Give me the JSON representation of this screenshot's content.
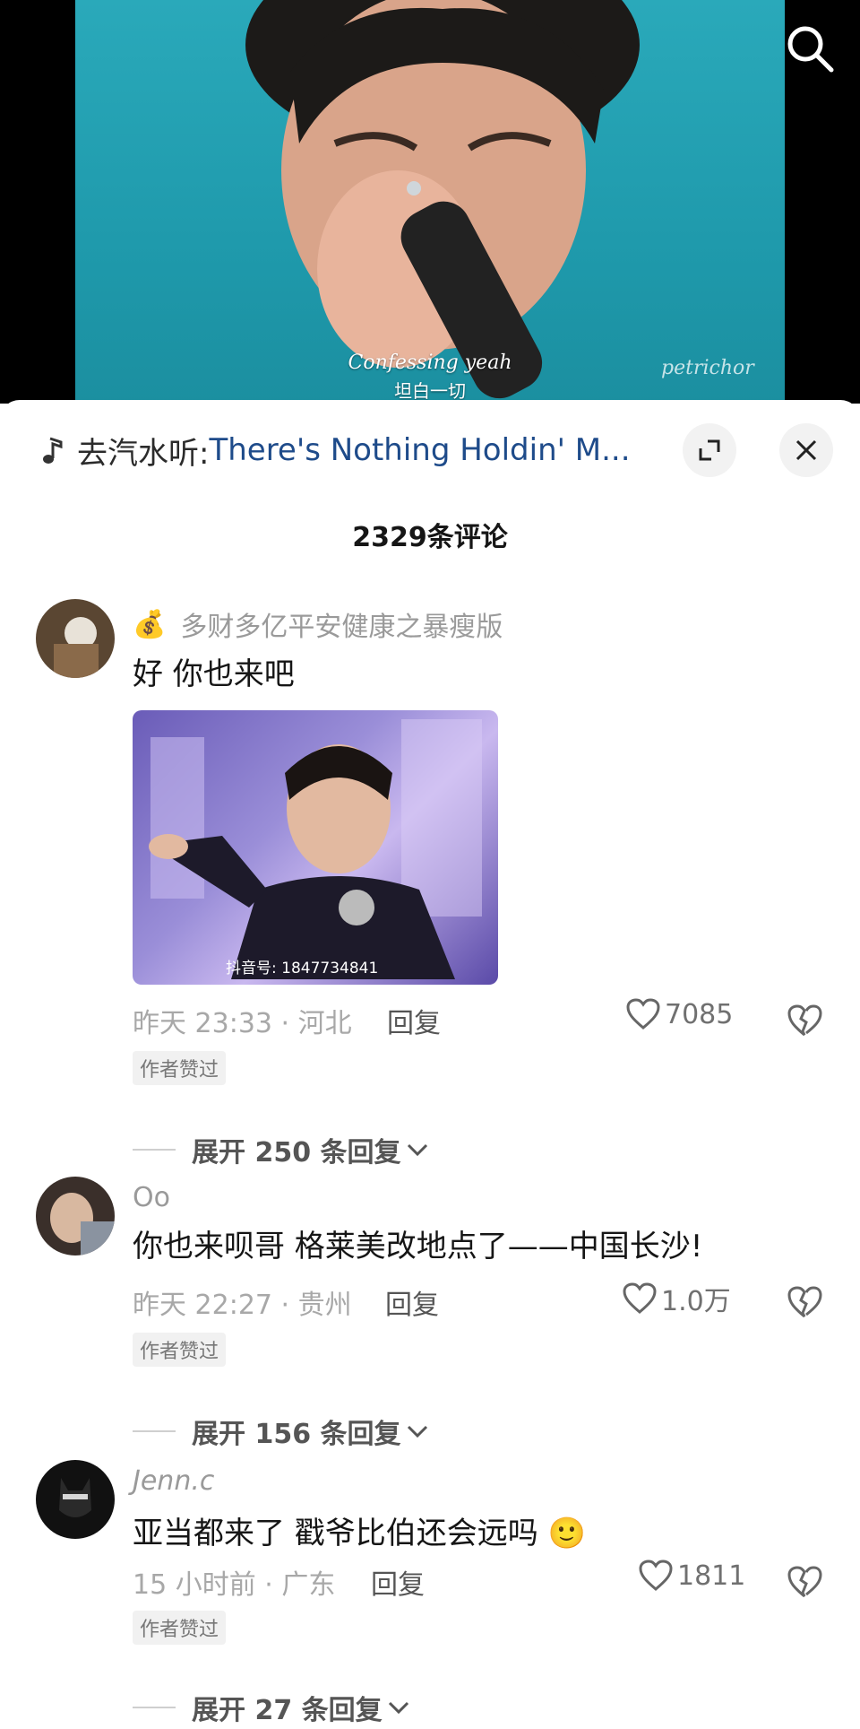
{
  "video": {
    "subtitle_en": "Confessing yeah",
    "subtitle_cn": "坦白一切",
    "watermark": "petrichor",
    "search_icon": "search-icon"
  },
  "music": {
    "prefix": "去汽水听:",
    "song": "There's Nothing Holdin' M..."
  },
  "comments_count": "2329条评论",
  "comments": [
    {
      "username": "多财多亿平安健康之暴瘦版",
      "badge_icon": "money-bag",
      "text": "好 你也来吧",
      "image_watermark": "抖音号: 1847734841",
      "time_loc": "昨天 23:33 · 河北",
      "reply": "回复",
      "likes": "7085",
      "author_badge": "作者赞过",
      "expand": "展开 250 条回复"
    },
    {
      "username": "Oo",
      "text": "你也来呗哥 格莱美改地点了——中国长沙!",
      "time_loc": "昨天 22:27 · 贵州",
      "reply": "回复",
      "likes": "1.0万",
      "author_badge": "作者赞过",
      "expand": "展开 156 条回复"
    },
    {
      "username": "Jenn.c",
      "text": "亚当都来了 戳爷比伯还会远吗",
      "emoji": "🙂",
      "time_loc": "15 小时前 · 广东",
      "reply": "回复",
      "likes": "1811",
      "author_badge": "作者赞过",
      "expand": "展开 27 条回复"
    }
  ]
}
